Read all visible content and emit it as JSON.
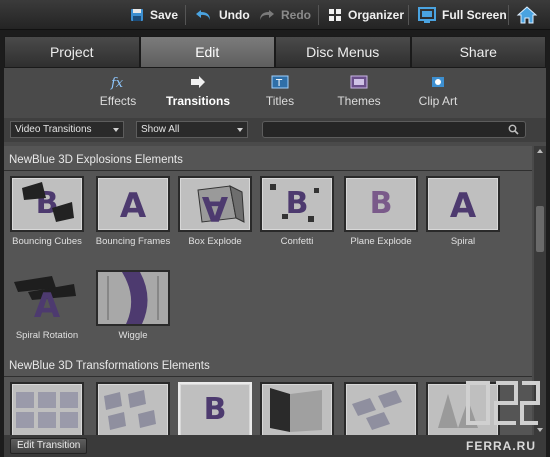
{
  "toolbar": {
    "save": "Save",
    "undo": "Undo",
    "redo": "Redo",
    "organizer": "Organizer",
    "full_screen": "Full Screen"
  },
  "tabs": [
    {
      "label": "Project"
    },
    {
      "label": "Edit",
      "active": true
    },
    {
      "label": "Disc Menus"
    },
    {
      "label": "Share"
    }
  ],
  "subnav": [
    {
      "label": "Effects",
      "icon": "fx-icon"
    },
    {
      "label": "Transitions",
      "icon": "transition-arrow-icon",
      "active": true
    },
    {
      "label": "Titles",
      "icon": "titles-icon"
    },
    {
      "label": "Themes",
      "icon": "themes-icon"
    },
    {
      "label": "Clip Art",
      "icon": "clipart-icon"
    }
  ],
  "filters": {
    "category": "Video Transitions",
    "show": "Show All",
    "search_value": ""
  },
  "sections": [
    {
      "title": "NewBlue 3D Explosions Elements",
      "items": [
        {
          "label": "Bouncing Cubes"
        },
        {
          "label": "Bouncing Frames"
        },
        {
          "label": "Box Explode"
        },
        {
          "label": "Confetti"
        },
        {
          "label": "Plane Explode"
        },
        {
          "label": "Spiral"
        },
        {
          "label": "Spiral Rotation"
        },
        {
          "label": "Wiggle"
        }
      ]
    },
    {
      "title": "NewBlue 3D Transformations Elements",
      "items": [
        {
          "label": ""
        },
        {
          "label": ""
        },
        {
          "label": "",
          "selected": true
        },
        {
          "label": ""
        },
        {
          "label": ""
        },
        {
          "label": ""
        }
      ]
    }
  ],
  "footer": {
    "edit_transition": "Edit Transition"
  },
  "watermark": {
    "text": "FERRA.RU"
  },
  "colors": {
    "panel": "#4a4a4a",
    "content": "#555555",
    "accent_purple": "#4d3a6f",
    "toolbar_icon_blue": "#4aa3e0"
  }
}
